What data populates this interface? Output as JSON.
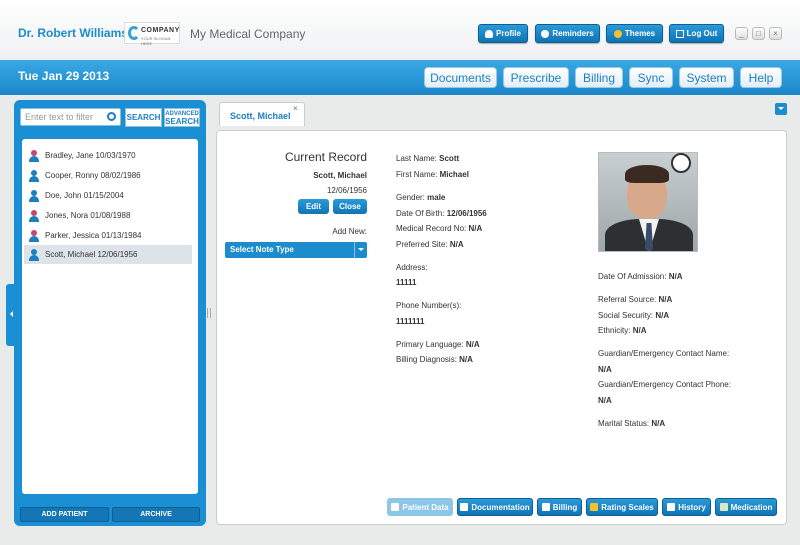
{
  "header": {
    "doctor_name": "Dr. Robert Williams",
    "logo_text": "COMPANY",
    "logo_sub": "YOUR SLOGAN HERE",
    "company_name": "My Medical Company",
    "buttons": {
      "profile": "Profile",
      "reminders": "Reminders",
      "themes": "Themes",
      "logout": "Log Out"
    },
    "window": {
      "minimize": "_",
      "maximize": "□",
      "close": "×"
    }
  },
  "nav": {
    "date": "Tue Jan 29 2013",
    "items": [
      "Documents",
      "Prescribe",
      "Billing",
      "Sync",
      "System",
      "Help"
    ]
  },
  "sidebar": {
    "filter_placeholder": "Enter text to filter",
    "search_label": "SEARCH",
    "advanced_label_1": "ADVANCED",
    "advanced_label_2": "SEARCH",
    "patients": [
      {
        "label": "Bradley, Jane 10/03/1970",
        "gender": "female"
      },
      {
        "label": "Cooper, Ronny 08/02/1986",
        "gender": "male"
      },
      {
        "label": "Doe, John 01/15/2004",
        "gender": "male"
      },
      {
        "label": "Jones, Nora 01/08/1988",
        "gender": "female"
      },
      {
        "label": "Parker, Jessica 01/13/1984",
        "gender": "female"
      },
      {
        "label": "Scott, Michael 12/06/1956",
        "gender": "male",
        "selected": true
      }
    ],
    "add_patient": "ADD PATIENT",
    "archive": "ARCHIVE"
  },
  "tab": {
    "label": "Scott, Michael",
    "close": "×"
  },
  "record": {
    "title": "Current Record",
    "name": "Scott, Michael",
    "dob": "12/06/1956",
    "edit": "Edit",
    "close": "Close",
    "add_new": "Add New:",
    "note_type": "Select Note Type"
  },
  "details": {
    "last_name_label": "Last Name:",
    "last_name": "Scott",
    "first_name_label": "First Name:",
    "first_name": "Michael",
    "gender_label": "Gender:",
    "gender": "male",
    "dob_label": "Date Of Birth:",
    "dob": "12/06/1956",
    "mrn_label": "Medical Record No:",
    "mrn": "N/A",
    "site_label": "Preferred Site:",
    "site": "N/A",
    "address_label": "Address:",
    "address": "11111",
    "phone_label": "Phone Number(s):",
    "phone": "1111111",
    "language_label": "Primary Language:",
    "language": "N/A",
    "billing_dx_label": "Billing Diagnosis:",
    "billing_dx": "N/A",
    "admission_label": "Date Of Admission:",
    "admission": "N/A",
    "referral_label": "Referral Source:",
    "referral": "N/A",
    "ssn_label": "Social Security:",
    "ssn": "N/A",
    "ethnicity_label": "Ethnicity:",
    "ethnicity": "N/A",
    "guardian_name_label": "Guardian/Emergency Contact Name:",
    "guardian_name": "N/A",
    "guardian_phone_label": "Guardian/Emergency Contact Phone:",
    "guardian_phone": "N/A",
    "marital_label": "Marital Status:",
    "marital": "N/A"
  },
  "bottom_tabs": [
    "Patient Data",
    "Documentation",
    "Billing",
    "Rating Scales",
    "History",
    "Medication"
  ]
}
